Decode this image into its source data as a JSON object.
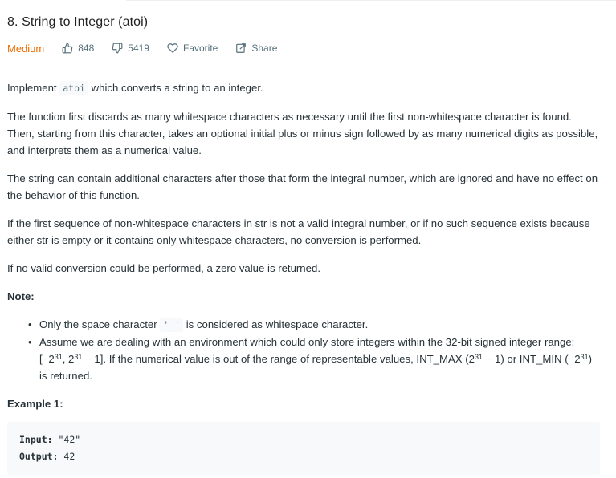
{
  "problem": {
    "title": "8. String to Integer (atoi)",
    "difficulty": "Medium",
    "likes": "848",
    "dislikes": "5419",
    "favorite_label": "Favorite",
    "share_label": "Share"
  },
  "description": {
    "p1_before": "Implement",
    "p1_code": "atoi",
    "p1_after": "which converts a string to an integer.",
    "p2": "The function first discards as many whitespace characters as necessary until the first non-whitespace character is found. Then, starting from this character, takes an optional initial plus or minus sign followed by as many numerical digits as possible, and interprets them as a numerical value.",
    "p3": "The string can contain additional characters after those that form the integral number, which are ignored and have no effect on the behavior of this function.",
    "p4": "If the first sequence of non-whitespace characters in str is not a valid integral number, or if no such sequence exists because either str is empty or it contains only whitespace characters, no conversion is performed.",
    "p5": "If no valid conversion could be performed, a zero value is returned.",
    "note_label": "Note:",
    "bullet1_before": "Only the space character",
    "bullet1_code": "' '",
    "bullet1_after": "is considered as whitespace character.",
    "bullet2": {
      "t1": "Assume we are dealing with an environment which could only store integers within the 32-bit signed integer range: [−2",
      "s1": "31",
      "t2": ",  2",
      "s2": "31",
      "t3": " − 1]. If the numerical value is out of the range of representable values, INT_MAX (2",
      "s3": "31",
      "t4": " − 1) or INT_MIN (−2",
      "s4": "31",
      "t5": ") is returned."
    },
    "example1_title": "Example 1:",
    "example1_input_label": "Input:",
    "example1_input_value": "\"42\"",
    "example1_output_label": "Output:",
    "example1_output_value": "42"
  }
}
